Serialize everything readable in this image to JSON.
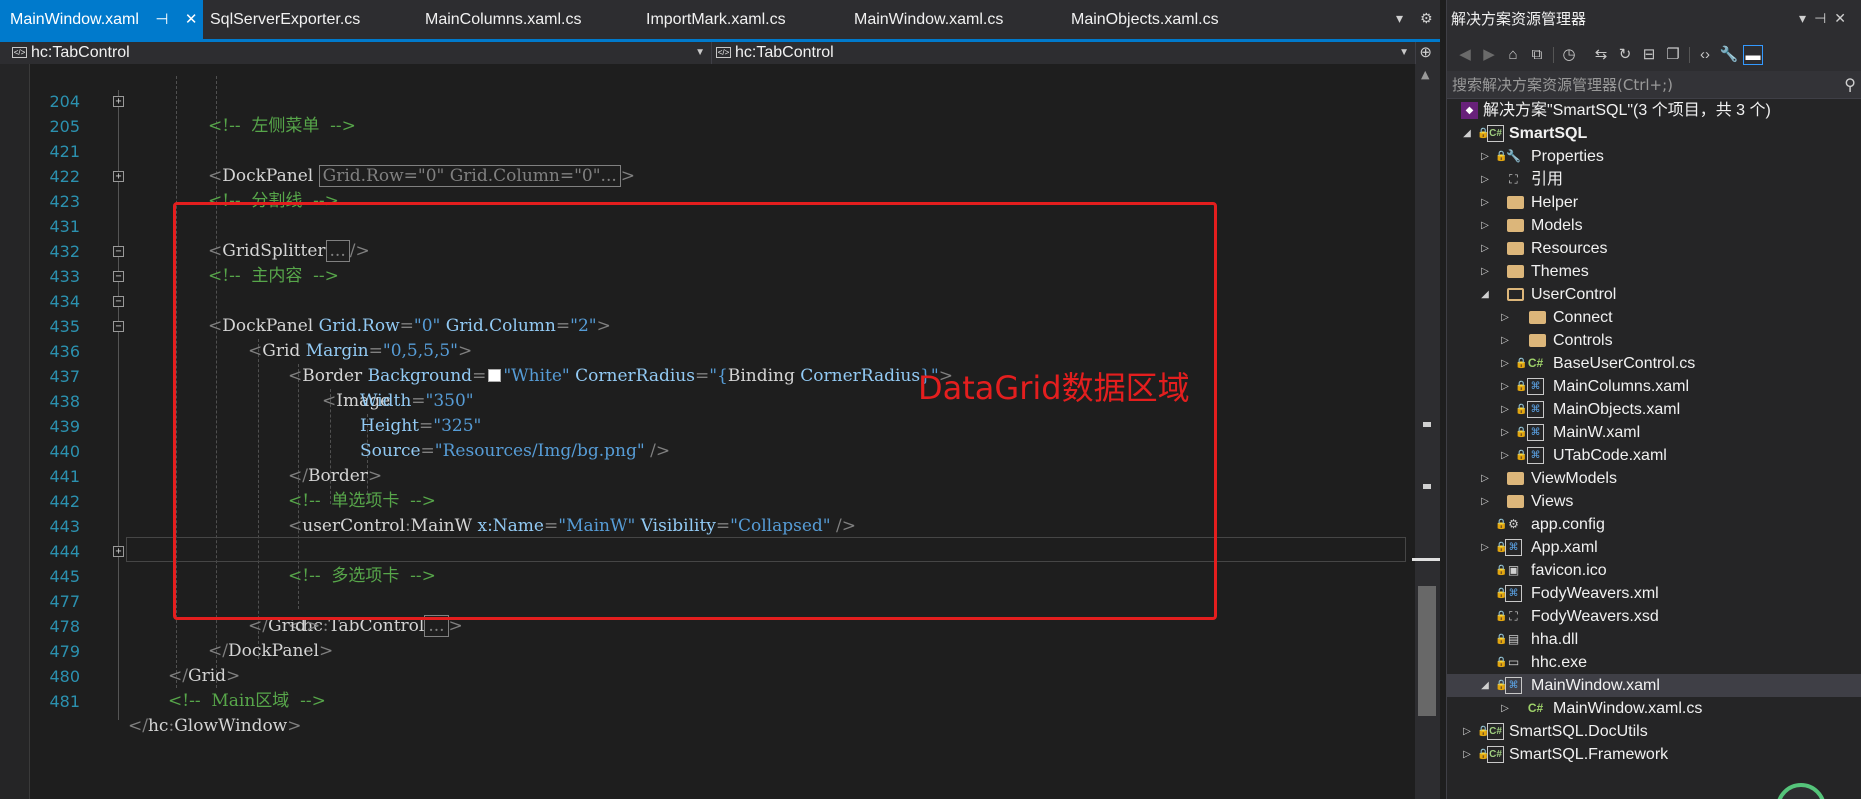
{
  "tabs": [
    {
      "label": "MainWindow.xaml",
      "active": true
    },
    {
      "label": "SqlServerExporter.cs"
    },
    {
      "label": "MainColumns.xaml.cs"
    },
    {
      "label": "ImportMark.xaml.cs"
    },
    {
      "label": "MainWindow.xaml.cs"
    },
    {
      "label": "MainObjects.xaml.cs"
    }
  ],
  "nav": {
    "left_combo": "hc:TabControl",
    "right_combo": "hc:TabControl"
  },
  "code": {
    "lines": [
      {
        "n": "204"
      },
      {
        "n": "205"
      },
      {
        "n": "421"
      },
      {
        "n": "422"
      },
      {
        "n": "423"
      },
      {
        "n": "431"
      },
      {
        "n": "432"
      },
      {
        "n": "433"
      },
      {
        "n": "434"
      },
      {
        "n": "435"
      },
      {
        "n": "436"
      },
      {
        "n": "437"
      },
      {
        "n": "438"
      },
      {
        "n": "439"
      },
      {
        "n": "440"
      },
      {
        "n": "441"
      },
      {
        "n": "442"
      },
      {
        "n": "443"
      },
      {
        "n": "444"
      },
      {
        "n": "445"
      },
      {
        "n": "477"
      },
      {
        "n": "478"
      },
      {
        "n": "479"
      },
      {
        "n": "480"
      },
      {
        "n": "481"
      }
    ],
    "t": {
      "c204": "<!--  左侧菜单  -->",
      "dock": "DockPanel",
      "collapsed205": "Grid.Row=\"0\" Grid.Column=\"0\"...",
      "c422": "<!--  分割线  -->",
      "gs": "GridSplitter",
      "dots": "...",
      "c432": "<!--  主内容  -->",
      "a_row": "Grid.Row",
      "v_row": "\"0\"",
      "a_col": "Grid.Column",
      "v_col": "\"2\"",
      "grid": "Grid",
      "a_margin": "Margin",
      "v_margin": "\"0,5,5,5\"",
      "border": "Border",
      "a_bg": "Background",
      "v_bg": "\"White\"",
      "a_cr": "CornerRadius",
      "v_cr1": "\"{",
      "v_cr2": "Binding",
      "v_cr3": "CornerRadius",
      "v_cr4": "}\"",
      "image": "Image",
      "a_w": "Width",
      "v_w": "\"350\"",
      "a_h": "Height",
      "v_h": "\"325\"",
      "a_src": "Source",
      "v_src": "\"Resources/Img/bg.png\"",
      "c441": "<!--  单选项卡  -->",
      "uc": "userControl",
      "mainw": "MainW",
      "a_name": "x:Name",
      "v_name": "\"MainW\"",
      "a_vis": "Visibility",
      "v_vis": "\"Collapsed\"",
      "c444": "<!--  多选项卡  -->",
      "hc": "hc",
      "tabc": "TabControl",
      "c480": "<!--  Main区域  -->",
      "glow": "GlowWindow"
    }
  },
  "annotation": "DataGrid数据区域",
  "solution": {
    "title": "解决方案资源管理器",
    "search_placeholder": "搜索解决方案资源管理器(Ctrl+;)",
    "items": [
      {
        "label": "解决方案\"SmartSQL\"(3 个项目，共 3 个)"
      },
      {
        "label": "SmartSQL"
      },
      {
        "label": "Properties"
      },
      {
        "label": "引用"
      },
      {
        "label": "Helper"
      },
      {
        "label": "Models"
      },
      {
        "label": "Resources"
      },
      {
        "label": "Themes"
      },
      {
        "label": "UserControl"
      },
      {
        "label": "Connect"
      },
      {
        "label": "Controls"
      },
      {
        "label": "BaseUserControl.cs"
      },
      {
        "label": "MainColumns.xaml"
      },
      {
        "label": "MainObjects.xaml"
      },
      {
        "label": "MainW.xaml"
      },
      {
        "label": "UTabCode.xaml"
      },
      {
        "label": "ViewModels"
      },
      {
        "label": "Views"
      },
      {
        "label": "app.config"
      },
      {
        "label": "App.xaml"
      },
      {
        "label": "favicon.ico"
      },
      {
        "label": "FodyWeavers.xml"
      },
      {
        "label": "FodyWeavers.xsd"
      },
      {
        "label": "hha.dll"
      },
      {
        "label": "hhc.exe"
      },
      {
        "label": "MainWindow.xaml"
      },
      {
        "label": "MainWindow.xaml.cs"
      },
      {
        "label": "SmartSQL.DocUtils"
      },
      {
        "label": "SmartSQL.Framework"
      }
    ]
  },
  "colors": {
    "accent": "#007acc",
    "annotation": "#e41e1e",
    "comment": "#57a64a",
    "value": "#569cd6"
  }
}
